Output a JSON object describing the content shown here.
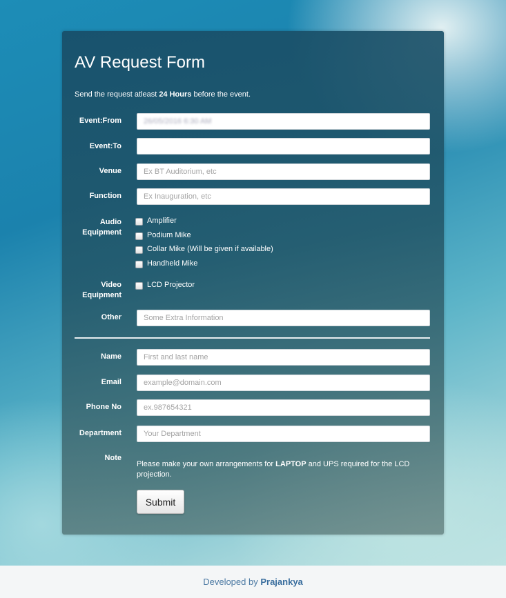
{
  "form": {
    "title": "AV Request Form",
    "intro_prefix": "Send the request atleast ",
    "intro_bold": "24 Hours",
    "intro_suffix": " before the event.",
    "labels": {
      "event_from": "Event:From",
      "event_to": "Event:To",
      "venue": "Venue",
      "function": "Function",
      "audio_line1": "Audio",
      "audio_line2": "Equipment",
      "video_line1": "Video",
      "video_line2": "Equipment",
      "other": "Other",
      "name": "Name",
      "email": "Email",
      "phone": "Phone No",
      "department": "Department",
      "note": "Note"
    },
    "fields": {
      "event_from_value": "26/05/2016 6:30 AM",
      "event_to_value": "",
      "venue_placeholder": "Ex BT Auditorium, etc",
      "function_placeholder": "Ex Inauguration, etc",
      "other_placeholder": "Some Extra Information",
      "name_placeholder": "First and last name",
      "email_placeholder": "example@domain.com",
      "phone_placeholder": "ex.987654321",
      "department_placeholder": "Your Department"
    },
    "audio_options": [
      {
        "label": "Amplifier",
        "checked": false
      },
      {
        "label": "Podium Mike",
        "checked": false
      },
      {
        "label": "Collar Mike (Will be given if available)",
        "checked": false
      },
      {
        "label": "Handheld Mike",
        "checked": false
      }
    ],
    "video_options": [
      {
        "label": "LCD Projector",
        "checked": false
      }
    ],
    "note_prefix": "Please make your own arrangements for ",
    "note_bold": "LAPTOP",
    "note_suffix": " and UPS required for the LCD projection.",
    "submit_label": "Submit"
  },
  "footer": {
    "prefix": "Developed by ",
    "author": "Prajankya"
  }
}
